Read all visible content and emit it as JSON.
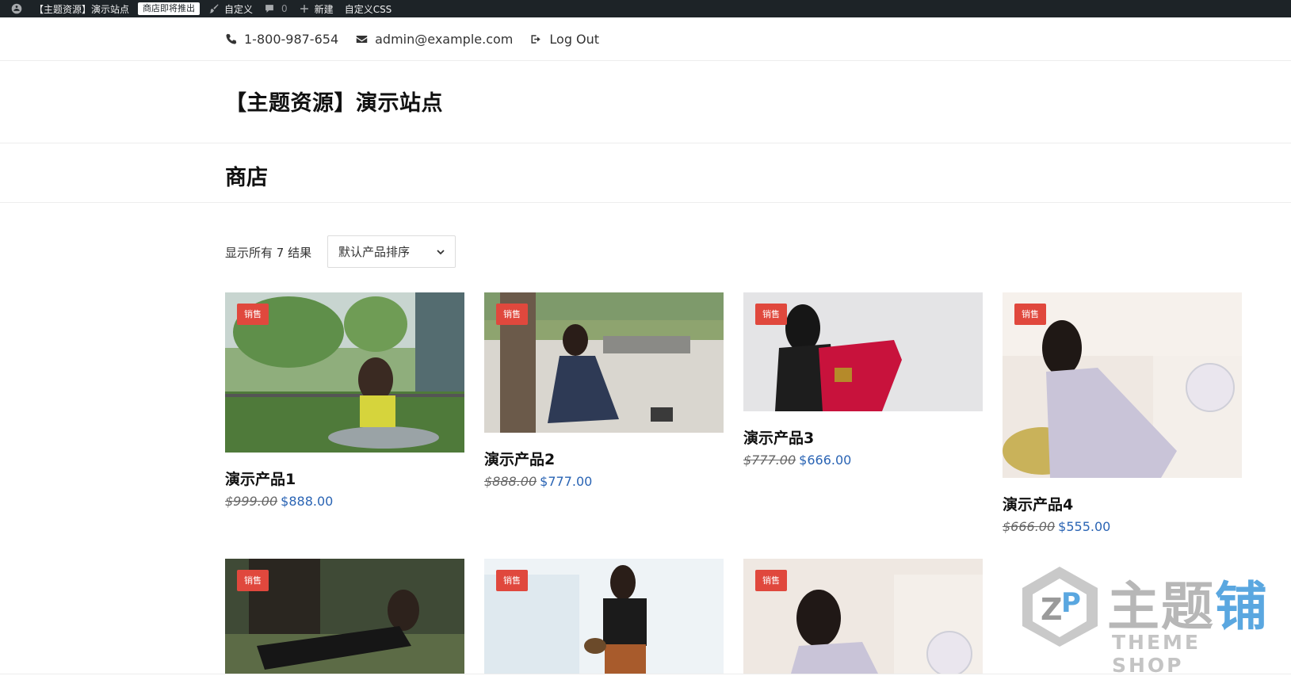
{
  "adminbar": {
    "site_name": "【主题资源】演示站点",
    "store_notice": "商店即将推出",
    "customize": "自定义",
    "comments_count": "0",
    "new": "新建",
    "custom_css": "自定义CSS"
  },
  "topbar": {
    "phone": "1-800-987-654",
    "email": "admin@example.com",
    "logout": "Log Out"
  },
  "site": {
    "title": "【主题资源】演示站点"
  },
  "page": {
    "title": "商店"
  },
  "shop": {
    "result_count": "显示所有 7 结果",
    "orderby_selected": "默认产品排序"
  },
  "products": [
    {
      "title": "演示产品1",
      "regular_price": "$999.00",
      "sale_price": "$888.00",
      "badge": "销售"
    },
    {
      "title": "演示产品2",
      "regular_price": "$888.00",
      "sale_price": "$777.00",
      "badge": "销售"
    },
    {
      "title": "演示产品3",
      "regular_price": "$777.00",
      "sale_price": "$666.00",
      "badge": "销售"
    },
    {
      "title": "演示产品4",
      "regular_price": "$666.00",
      "sale_price": "$555.00",
      "badge": "销售"
    },
    {
      "badge": "销售"
    },
    {
      "badge": "销售"
    },
    {
      "badge": "销售"
    }
  ],
  "watermark": {
    "main": "主题",
    "accent": "铺",
    "sub": "THEME SHOP"
  },
  "colors": {
    "adminbar": "#1d2327",
    "sale_badge": "#e0483d",
    "sale_price": "#2a64b4"
  }
}
